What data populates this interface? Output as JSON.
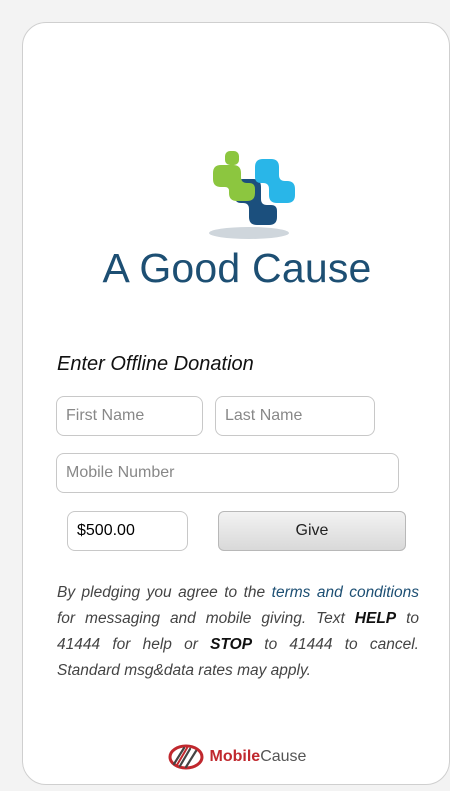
{
  "organization": {
    "name": "A Good Cause",
    "logo_icon": "puzzle-cross-logo-icon"
  },
  "form": {
    "heading": "Enter Offline Donation",
    "first_name_placeholder": "First Name",
    "last_name_placeholder": "Last Name",
    "mobile_placeholder": "Mobile Number",
    "amount_value": "$500.00",
    "give_label": "Give"
  },
  "disclaimer": {
    "part1": "By pledging you agree to the ",
    "terms_link": "terms and conditions",
    "part2": " for messaging and mobile giving. Text ",
    "help_keyword": "HELP",
    "part3": " to 41444 for help or ",
    "stop_keyword": "STOP",
    "part4": " to 41444 to cancel. Standard msg&data rates may apply."
  },
  "brand": {
    "name_part1": "Mobile",
    "name_part2": "Cause",
    "icon": "mobilecause-swirl-icon"
  },
  "colors": {
    "title_blue": "#1d4f73",
    "logo_green": "#8cc63f",
    "logo_light_blue": "#29b6e8",
    "logo_dark_blue": "#1b4f7d",
    "brand_red": "#c0282e"
  }
}
